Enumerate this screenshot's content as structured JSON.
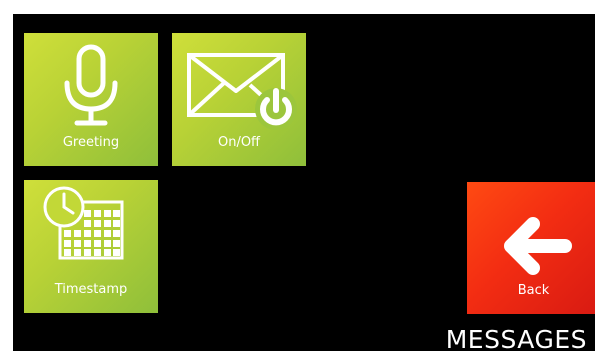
{
  "screen": {
    "title": "MESSAGES"
  },
  "tiles": {
    "greeting": {
      "label": "Greeting",
      "icon": "microphone-icon"
    },
    "onoff": {
      "label": "On/Off",
      "icon": "envelope-power-icon"
    },
    "timestamp": {
      "label": "Timestamp",
      "icon": "clock-calendar-icon"
    },
    "back": {
      "label": "Back",
      "icon": "arrow-left-icon"
    }
  },
  "colors": {
    "background": "#000000",
    "tile_green": "#b9d236",
    "tile_red": "#f32d12",
    "text": "#ffffff"
  }
}
